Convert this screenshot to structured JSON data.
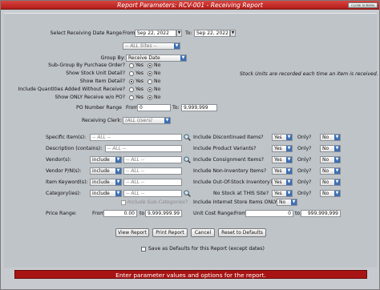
{
  "window": {
    "title": "Report Parameters: RCV-001 - Receiving Report",
    "close_label": "CLOSE SCREEN"
  },
  "date_range": {
    "label": "Select Receiving Date Range",
    "from_label": "From:",
    "from_value": "Sep 22, 2022",
    "to_label": "To:",
    "to_value": "Sep 22, 2022"
  },
  "sites": {
    "value": "-- ALL Sites --"
  },
  "group_by": {
    "label": "Group By:",
    "value": "Receive Date"
  },
  "options": [
    {
      "label": "Sub-Group By Purchase Order?",
      "yes": "Yes",
      "no": "No",
      "selected": "No"
    },
    {
      "label": "Show Stock Unit Detail?",
      "yes": "Yes",
      "no": "No",
      "selected": "No"
    },
    {
      "label": "Show Item Detail?",
      "yes": "Yes",
      "no": "No",
      "selected": "Yes"
    },
    {
      "label": "Include Quantities Added Without Receive?",
      "yes": "Yes",
      "no": "No",
      "selected": "No"
    },
    {
      "label": "Show ONLY Receive w/o PO?",
      "yes": "Yes",
      "no": "No",
      "selected": "No"
    }
  ],
  "stock_note": "Stock Units are recorded each time an item is received.",
  "po_range": {
    "label": "PO Number Range",
    "from_label": "From:",
    "from_value": "0",
    "to_label": "To:",
    "to_value": "9,999,999"
  },
  "receiving_clerk": {
    "label": "Receiving Clerk:",
    "value": "(ALL Users)"
  },
  "filters": [
    {
      "label": "Specific Item(s):",
      "mode": null,
      "value": "-- ALL --"
    },
    {
      "label": "Description (contains):",
      "mode": null,
      "value": "-- ALL --"
    },
    {
      "label": "Vendor(s):",
      "mode": "include",
      "value": "-- ALL --"
    },
    {
      "label": "Vendor P/N(s):",
      "mode": "include",
      "value": "-- ALL --"
    },
    {
      "label": "Item Keyword(s):",
      "mode": "include",
      "value": "-- ALL --"
    },
    {
      "label": "Category(ies):",
      "mode": "include",
      "value": "-- ALL --"
    }
  ],
  "sub_categories": "Include Sub-Categories?",
  "right_options": [
    {
      "label": "Include Discontinued Items?",
      "value": "Yes",
      "only_label": "Only?",
      "only_value": "No"
    },
    {
      "label": "Include Product Variants?",
      "value": "Yes",
      "only_label": "Only?",
      "only_value": "No"
    },
    {
      "label": "Include Consignment Items?",
      "value": "Yes",
      "only_label": "Only?",
      "only_value": "No"
    },
    {
      "label": "Include Non-Inventory Items?",
      "value": "Yes",
      "only_label": "Only?",
      "only_value": "No"
    },
    {
      "label": "Include Out-Of-Stock Inventory?",
      "value": "Yes",
      "only_label": "Only?",
      "only_value": "No"
    },
    {
      "label": "No Stock at THIS Site?",
      "value": "Yes",
      "only_label": "Only?",
      "only_value": "No"
    },
    {
      "label": "Include Internet Store Items ONLY?",
      "value": "No",
      "only_label": "",
      "only_value": ""
    }
  ],
  "price_range": {
    "label": "Price Range:",
    "from_label": "From",
    "from_value": "0.00",
    "to_label": "to",
    "to_value": "9,999,999.99"
  },
  "unit_cost_range": {
    "label": "Unit Cost Range:",
    "from_label": "From",
    "from_value": "0",
    "to_label": "to",
    "to_value": "999,999,999"
  },
  "buttons": {
    "view": "View Report",
    "print": "Print Report",
    "cancel": "Cancel",
    "reset": "Reset to Defaults"
  },
  "save_defaults": "Save as Defaults for this Report (except dates)",
  "status": "Enter parameter values and options for the report."
}
